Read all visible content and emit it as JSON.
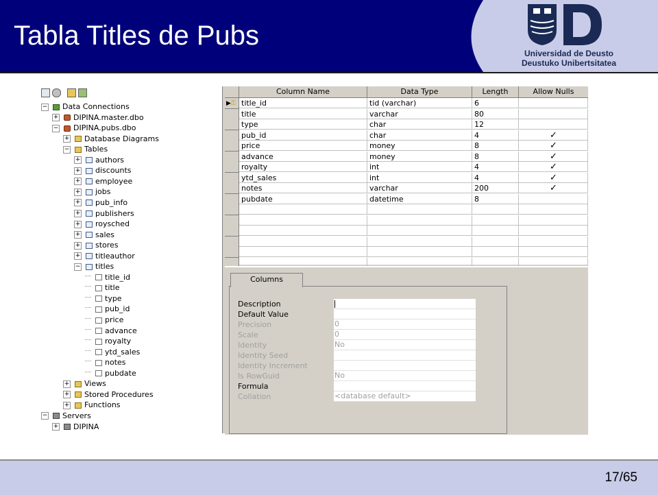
{
  "slide": {
    "title": "Tabla Titles de Pubs",
    "page_number": "17/65"
  },
  "logo": {
    "line1": "Universidad de Deusto",
    "line2": "Deustuko Unibertsitatea"
  },
  "tree": {
    "items": [
      {
        "label": "Data Connections",
        "exp": "−",
        "icon": "connection-icon",
        "level": 0
      },
      {
        "label": "DIPINA.master.dbo",
        "exp": "+",
        "icon": "database-icon",
        "level": 1
      },
      {
        "label": "DIPINA.pubs.dbo",
        "exp": "−",
        "icon": "database-icon",
        "level": 1
      },
      {
        "label": "Database Diagrams",
        "exp": "+",
        "icon": "folder-icon",
        "level": 2
      },
      {
        "label": "Tables",
        "exp": "−",
        "icon": "folder-icon",
        "level": 2
      },
      {
        "label": "authors",
        "exp": "+",
        "icon": "table-icon",
        "level": 3
      },
      {
        "label": "discounts",
        "exp": "+",
        "icon": "table-icon",
        "level": 3
      },
      {
        "label": "employee",
        "exp": "+",
        "icon": "table-icon",
        "level": 3
      },
      {
        "label": "jobs",
        "exp": "+",
        "icon": "table-icon",
        "level": 3
      },
      {
        "label": "pub_info",
        "exp": "+",
        "icon": "table-icon",
        "level": 3
      },
      {
        "label": "publishers",
        "exp": "+",
        "icon": "table-icon",
        "level": 3
      },
      {
        "label": "roysched",
        "exp": "+",
        "icon": "table-icon",
        "level": 3
      },
      {
        "label": "sales",
        "exp": "+",
        "icon": "table-icon",
        "level": 3
      },
      {
        "label": "stores",
        "exp": "+",
        "icon": "table-icon",
        "level": 3
      },
      {
        "label": "titleauthor",
        "exp": "+",
        "icon": "table-icon",
        "level": 3
      },
      {
        "label": "titles",
        "exp": "−",
        "icon": "table-icon",
        "level": 3
      },
      {
        "label": "title_id",
        "exp": "",
        "icon": "column-icon",
        "level": 4
      },
      {
        "label": "title",
        "exp": "",
        "icon": "column-icon",
        "level": 4
      },
      {
        "label": "type",
        "exp": "",
        "icon": "column-icon",
        "level": 4
      },
      {
        "label": "pub_id",
        "exp": "",
        "icon": "column-icon",
        "level": 4
      },
      {
        "label": "price",
        "exp": "",
        "icon": "column-icon",
        "level": 4
      },
      {
        "label": "advance",
        "exp": "",
        "icon": "column-icon",
        "level": 4
      },
      {
        "label": "royalty",
        "exp": "",
        "icon": "column-icon",
        "level": 4
      },
      {
        "label": "ytd_sales",
        "exp": "",
        "icon": "column-icon",
        "level": 4
      },
      {
        "label": "notes",
        "exp": "",
        "icon": "column-icon",
        "level": 4
      },
      {
        "label": "pubdate",
        "exp": "",
        "icon": "column-icon",
        "level": 4
      },
      {
        "label": "Views",
        "exp": "+",
        "icon": "folder-icon",
        "level": 2
      },
      {
        "label": "Stored Procedures",
        "exp": "+",
        "icon": "folder-icon",
        "level": 2
      },
      {
        "label": "Functions",
        "exp": "+",
        "icon": "folder-icon",
        "level": 2
      },
      {
        "label": "Servers",
        "exp": "−",
        "icon": "server-icon",
        "level": 0
      },
      {
        "label": "DIPINA",
        "exp": "+",
        "icon": "server-icon",
        "level": 1
      }
    ]
  },
  "grid": {
    "headers": [
      "Column Name",
      "Data Type",
      "Length",
      "Allow Nulls"
    ],
    "rows": [
      {
        "name": "title_id",
        "type": "tid (varchar)",
        "length": "6",
        "nulls": false,
        "key": true
      },
      {
        "name": "title",
        "type": "varchar",
        "length": "80",
        "nulls": false
      },
      {
        "name": "type",
        "type": "char",
        "length": "12",
        "nulls": false
      },
      {
        "name": "pub_id",
        "type": "char",
        "length": "4",
        "nulls": true
      },
      {
        "name": "price",
        "type": "money",
        "length": "8",
        "nulls": true
      },
      {
        "name": "advance",
        "type": "money",
        "length": "8",
        "nulls": true
      },
      {
        "name": "royalty",
        "type": "int",
        "length": "4",
        "nulls": true
      },
      {
        "name": "ytd_sales",
        "type": "int",
        "length": "4",
        "nulls": true
      },
      {
        "name": "notes",
        "type": "varchar",
        "length": "200",
        "nulls": true
      },
      {
        "name": "pubdate",
        "type": "datetime",
        "length": "8",
        "nulls": false
      }
    ],
    "check_glyph": "✓",
    "empty_rows": 6
  },
  "properties": {
    "tab_label": "Columns",
    "items": [
      {
        "label": "Description",
        "value": "",
        "enabled": true,
        "cursor": true
      },
      {
        "label": "Default Value",
        "value": "",
        "enabled": true
      },
      {
        "label": "Precision",
        "value": "0",
        "enabled": false
      },
      {
        "label": "Scale",
        "value": "0",
        "enabled": false
      },
      {
        "label": "Identity",
        "value": "No",
        "enabled": false
      },
      {
        "label": "Identity Seed",
        "value": "",
        "enabled": false
      },
      {
        "label": "Identity Increment",
        "value": "",
        "enabled": false
      },
      {
        "label": "Is RowGuid",
        "value": "No",
        "enabled": false
      },
      {
        "label": "Formula",
        "value": "",
        "enabled": true
      },
      {
        "label": "Collation",
        "value": "<database default>",
        "enabled": false
      }
    ]
  },
  "colors": {
    "header_bg": "#00007a",
    "footer_bg": "#c9cce8",
    "logo_bg": "#c9cce8",
    "logo_fg": "#1a2a55"
  }
}
